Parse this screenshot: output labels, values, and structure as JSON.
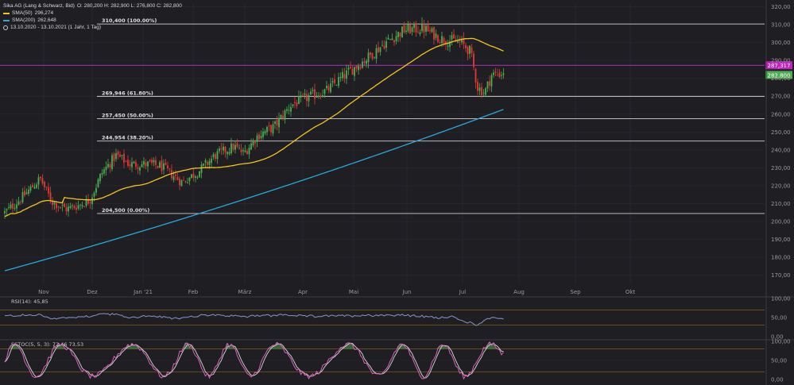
{
  "header": {
    "instrument": "Sika AG (Lang & Schwarz, Bid)",
    "ohlc": "O: 280,200   H: 282,900   L: 276,800   C: 282,800",
    "sma50_label": "SMA(50)",
    "sma50_value": "296,274",
    "sma200_label": "SMA(200)",
    "sma200_value": "262,648",
    "range": "13.10.2020 - 13.10.2021  (1 Jahr, 1 Tag)"
  },
  "colors": {
    "background": "#1e1e23",
    "grid": "#26262c",
    "up": "#4caf50",
    "down": "#e53935",
    "sma50": "#f5c518",
    "sma200": "#29a8e0",
    "level_line": "#d0d0d0",
    "resistance": "#b030c0",
    "rsi": "#8c92c8",
    "stoch_k": "#e060c0",
    "stoch_d": "#d8d8d8",
    "stoch_fill": "#3e7a3e",
    "band": "#7a5a1e",
    "label_bg_purple": "#c020c0",
    "label_bg_green": "#4caf50"
  },
  "chart_data": [
    {
      "type": "candlestick",
      "title": "Sika AG (Lang & Schwarz, Bid)",
      "x_ticks": [
        "Nov",
        "Dez",
        "Jan '21",
        "Feb",
        "März",
        "Apr",
        "Mai",
        "Jun",
        "Jul",
        "Aug",
        "Sep",
        "Okt"
      ],
      "y_ticks": [
        170,
        180,
        190,
        200,
        210,
        220,
        230,
        240,
        250,
        260,
        270,
        280,
        290,
        300,
        310,
        320
      ],
      "y_tick_labels": [
        "170,00",
        "180,00",
        "190,00",
        "200,00",
        "210,00",
        "220,00",
        "230,00",
        "240,00",
        "250,00",
        "260,00",
        "270,00",
        "280,00",
        "290,00",
        "300,00",
        "310,00",
        "320,00"
      ],
      "ylim": [
        165,
        322
      ],
      "trend_anchors": [
        {
          "month": 0,
          "value": 205
        },
        {
          "month": 0.35,
          "value": 213
        },
        {
          "month": 0.75,
          "value": 224
        },
        {
          "month": 1.0,
          "value": 211
        },
        {
          "month": 1.3,
          "value": 207
        },
        {
          "month": 1.55,
          "value": 209
        },
        {
          "month": 1.8,
          "value": 212
        },
        {
          "month": 2.05,
          "value": 227
        },
        {
          "month": 2.35,
          "value": 237
        },
        {
          "month": 2.65,
          "value": 232
        },
        {
          "month": 3.05,
          "value": 232
        },
        {
          "month": 3.3,
          "value": 231
        },
        {
          "month": 3.55,
          "value": 226
        },
        {
          "month": 3.75,
          "value": 222
        },
        {
          "month": 4.1,
          "value": 228
        },
        {
          "month": 4.45,
          "value": 237
        },
        {
          "month": 4.85,
          "value": 242
        },
        {
          "month": 5.05,
          "value": 238
        },
        {
          "month": 5.35,
          "value": 248
        },
        {
          "month": 5.7,
          "value": 253
        },
        {
          "month": 6.05,
          "value": 265
        },
        {
          "month": 6.45,
          "value": 270
        },
        {
          "month": 6.8,
          "value": 273
        },
        {
          "month": 7.2,
          "value": 282
        },
        {
          "month": 7.65,
          "value": 291
        },
        {
          "month": 8.05,
          "value": 300
        },
        {
          "month": 8.45,
          "value": 307
        },
        {
          "month": 8.85,
          "value": 308
        },
        {
          "month": 9.25,
          "value": 302
        },
        {
          "month": 9.65,
          "value": 300
        },
        {
          "month": 9.85,
          "value": 295
        },
        {
          "month": 10.0,
          "value": 275
        },
        {
          "month": 10.15,
          "value": 272
        },
        {
          "month": 10.3,
          "value": 282
        },
        {
          "month": 10.55,
          "value": 282.8
        }
      ],
      "sma50_value": 296.274,
      "sma200_value": 262.648,
      "fibonacci_levels": [
        {
          "value": 310.4,
          "label": "310,400 (100.00%)"
        },
        {
          "value": 269.946,
          "label": "269,946 (61.80%)"
        },
        {
          "value": 257.45,
          "label": "257,450 (50.00%)"
        },
        {
          "value": 244.954,
          "label": "244,954 (38.20%)"
        },
        {
          "value": 204.5,
          "label": "204,500 (0.00%)"
        }
      ],
      "resistance_level": 287.317,
      "resistance_label": "287,317",
      "last_price": 282.8,
      "last_price_label": "282,800"
    },
    {
      "type": "line",
      "title": "RSI(14): 45,85",
      "y_tick_labels": [
        "100,00",
        "50,00",
        "0,00"
      ],
      "ylim": [
        0,
        100
      ],
      "bands": [
        30,
        70
      ],
      "last_value": 45.85
    },
    {
      "type": "line",
      "title": "SSTOC(5, 5, 3): 72,46  73,53",
      "y_tick_labels": [
        "100,00",
        "50,00",
        "0,00"
      ],
      "ylim": [
        0,
        100
      ],
      "bands": [
        20,
        80
      ],
      "k_last": 72.46,
      "d_last": 73.53
    }
  ]
}
